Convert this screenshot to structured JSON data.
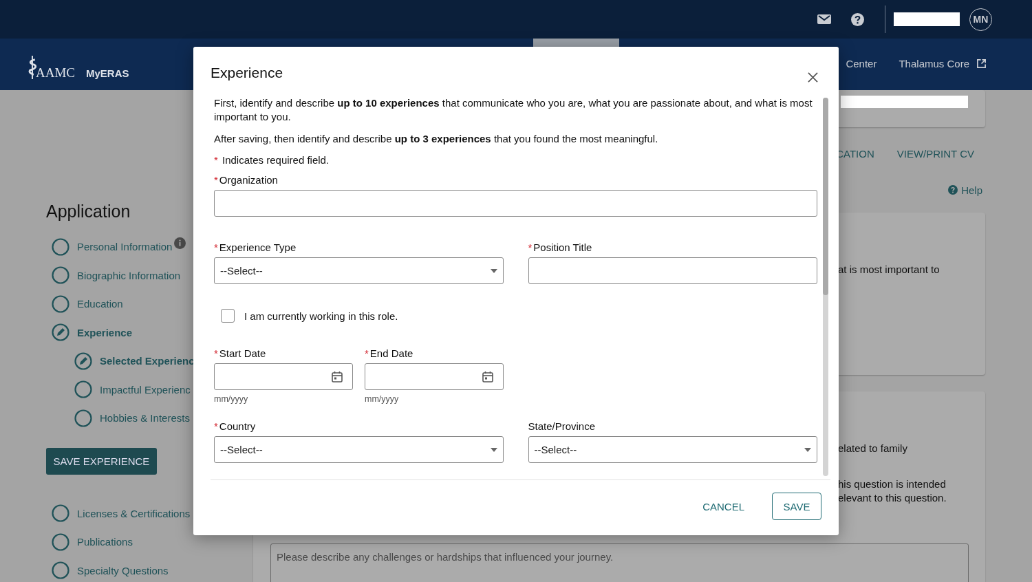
{
  "header": {
    "avatar_initials": "MN"
  },
  "nav": {
    "logo_text": "AAMC",
    "app_name": "MyERAS",
    "links": [
      {
        "label": "Center",
        "external": false
      },
      {
        "label": "Thalamus Core",
        "external": true
      }
    ]
  },
  "sidebar": {
    "title": "Application",
    "items_before": [
      {
        "label": "Personal Information",
        "editing": false,
        "selected": false,
        "info": true
      },
      {
        "label": "Biographic Information",
        "editing": false,
        "selected": false,
        "info": false
      },
      {
        "label": "Education",
        "editing": false,
        "selected": false,
        "info": false
      },
      {
        "label": "Experience",
        "editing": true,
        "selected": true,
        "info": false,
        "children": [
          {
            "label": "Selected Experienc",
            "editing": true,
            "selected": true
          },
          {
            "label": "Impactful Experienc",
            "editing": false,
            "selected": false
          },
          {
            "label": "Hobbies & Interests",
            "editing": false,
            "selected": false
          }
        ]
      }
    ],
    "save_button": "SAVE EXPERIENCE",
    "items_after": [
      {
        "label": "Licenses & Certifications",
        "editing": false,
        "selected": false,
        "info": false
      },
      {
        "label": "Publications",
        "editing": false,
        "selected": false,
        "info": false
      },
      {
        "label": "Specialty Questions",
        "editing": false,
        "selected": false,
        "info": false
      }
    ]
  },
  "main": {
    "tabs": [
      {
        "label": "CATION"
      },
      {
        "label": "VIEW/PRINT CV"
      }
    ],
    "help_link": "Help",
    "card_1_lines": [
      "at is most important to"
    ],
    "card_2_lines": [
      "elated to family",
      "his question is intended",
      "elevant to this question."
    ],
    "textarea": {
      "placeholder": "Please describe any challenges or hardships that influenced your journey."
    }
  },
  "modal": {
    "title": "Experience",
    "required_marker": "*",
    "paragraphs": [
      "First, identify and describe **up to 10 experiences** that communicate who you are, what you are passionate about, and what is most important to you.",
      "After saving, then identify and describe **up to 3 experiences** that you found the most meaningful."
    ],
    "required_note": "Indicates required field.",
    "rows": [
      {
        "fields": [
          {
            "kind": "text",
            "label": "Organization",
            "required": true
          }
        ]
      },
      {
        "fields": [
          {
            "kind": "select",
            "label": "Experience Type",
            "required": true,
            "value": "--Select--"
          },
          {
            "kind": "text",
            "label": "Position Title",
            "required": true
          }
        ]
      },
      {
        "fields": [
          {
            "kind": "checkbox",
            "label": "I am currently working in this role.",
            "checked": false
          }
        ]
      },
      {
        "fields": [
          {
            "kind": "date",
            "label": "Start Date",
            "required": true,
            "hint": "mm/yyyy"
          },
          {
            "kind": "date",
            "label": "End Date",
            "required": true,
            "hint": "mm/yyyy"
          }
        ]
      },
      {
        "fields": [
          {
            "kind": "select",
            "label": "Country",
            "required": true,
            "value": "--Select--"
          },
          {
            "kind": "select",
            "label": "State/Province",
            "required": false,
            "value": "--Select--"
          }
        ]
      }
    ],
    "buttons": [
      {
        "label": "CANCEL",
        "kind": "text"
      },
      {
        "label": "SAVE",
        "kind": "outlined"
      }
    ]
  }
}
